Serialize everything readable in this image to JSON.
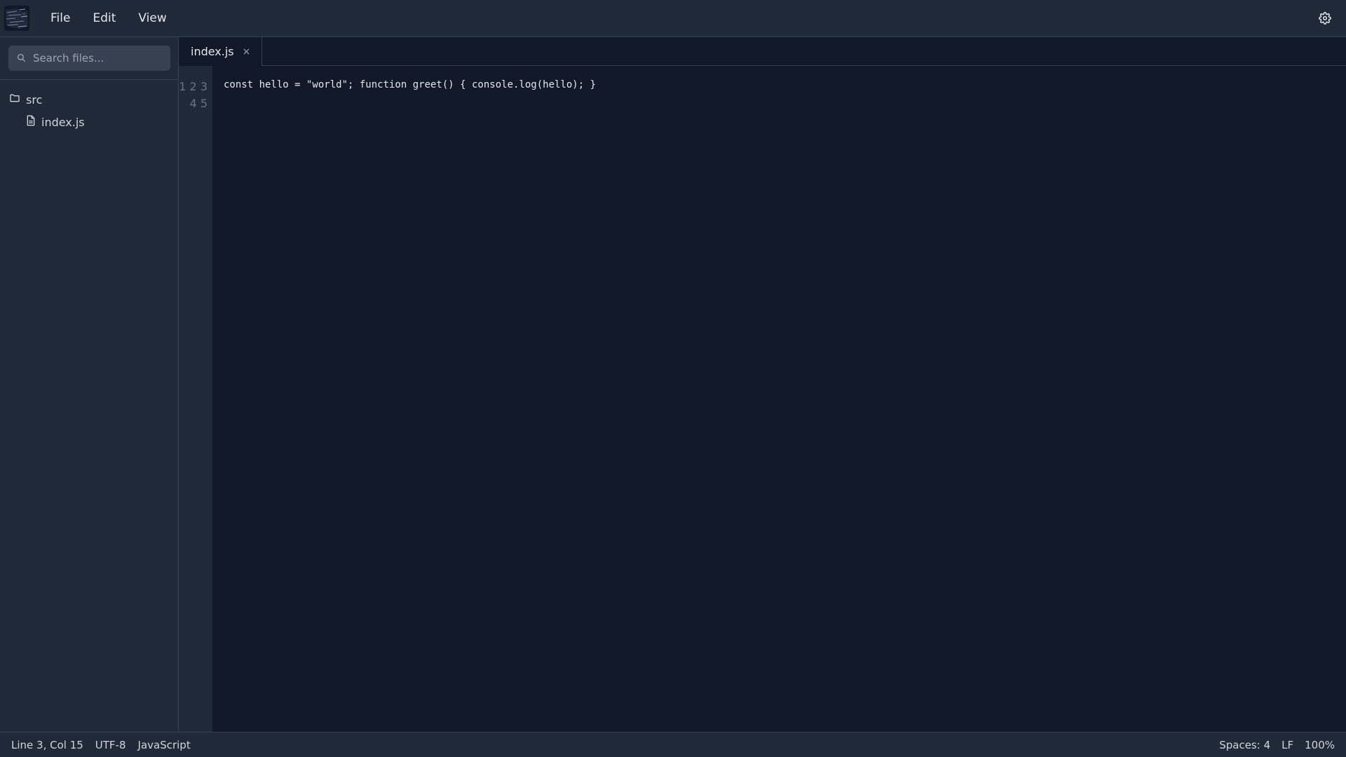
{
  "menu": {
    "file": "File",
    "edit": "Edit",
    "view": "View"
  },
  "icons": {
    "logo": "app-logo",
    "settings": "gear-icon",
    "search": "search-icon",
    "folder": "folder-icon",
    "file": "file-icon",
    "close": "close-icon"
  },
  "sidebar": {
    "search_placeholder": "Search files...",
    "folder_label": "src",
    "file_label": "index.js"
  },
  "editor": {
    "tab_label": "index.js",
    "tab_close": "×",
    "line_numbers": "1 2 3 4 5",
    "code": "const hello = \"world\"; function greet() { console.log(hello); }"
  },
  "status": {
    "position": "Line 3, Col 15",
    "encoding": "UTF-8",
    "language": "JavaScript",
    "indent": "Spaces: 4",
    "eol": "LF",
    "zoom": "100%"
  },
  "colors": {
    "background": "#111827",
    "panel": "#1f2937",
    "border": "#374151",
    "text": "#e5e7eb",
    "muted": "#9ca3af"
  }
}
